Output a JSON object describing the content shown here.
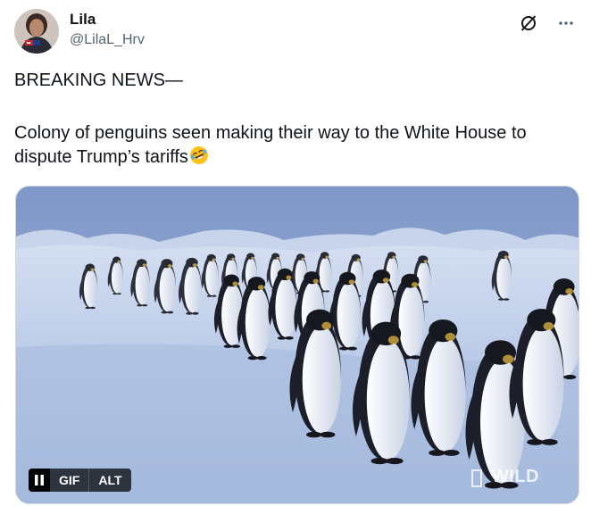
{
  "author": {
    "display_name": "Lila",
    "handle": "@LilaL_Hrv",
    "avatar_icon": "avatar-photo"
  },
  "header_actions": {
    "grok_icon": "slashed-circle-icon",
    "more_icon": "more-horizontal-icon"
  },
  "post": {
    "headline": "BREAKING NEWS—",
    "body": "Colony of penguins seen making their way to the White House to dispute Trump’s tariffs",
    "emoji": "rolling-on-floor-laughing-emoji"
  },
  "media": {
    "type": "gif",
    "pause_icon": "pause-icon",
    "gif_label": "GIF",
    "alt_label": "ALT",
    "watermark": "WILD"
  },
  "colors": {
    "text_primary": "#0f1419",
    "text_secondary": "#536471",
    "sky": "#8fa6cf",
    "ice": "#c9d6ee",
    "penguin_back": "#1c1f2a",
    "penguin_belly": "#e8ecf4"
  }
}
